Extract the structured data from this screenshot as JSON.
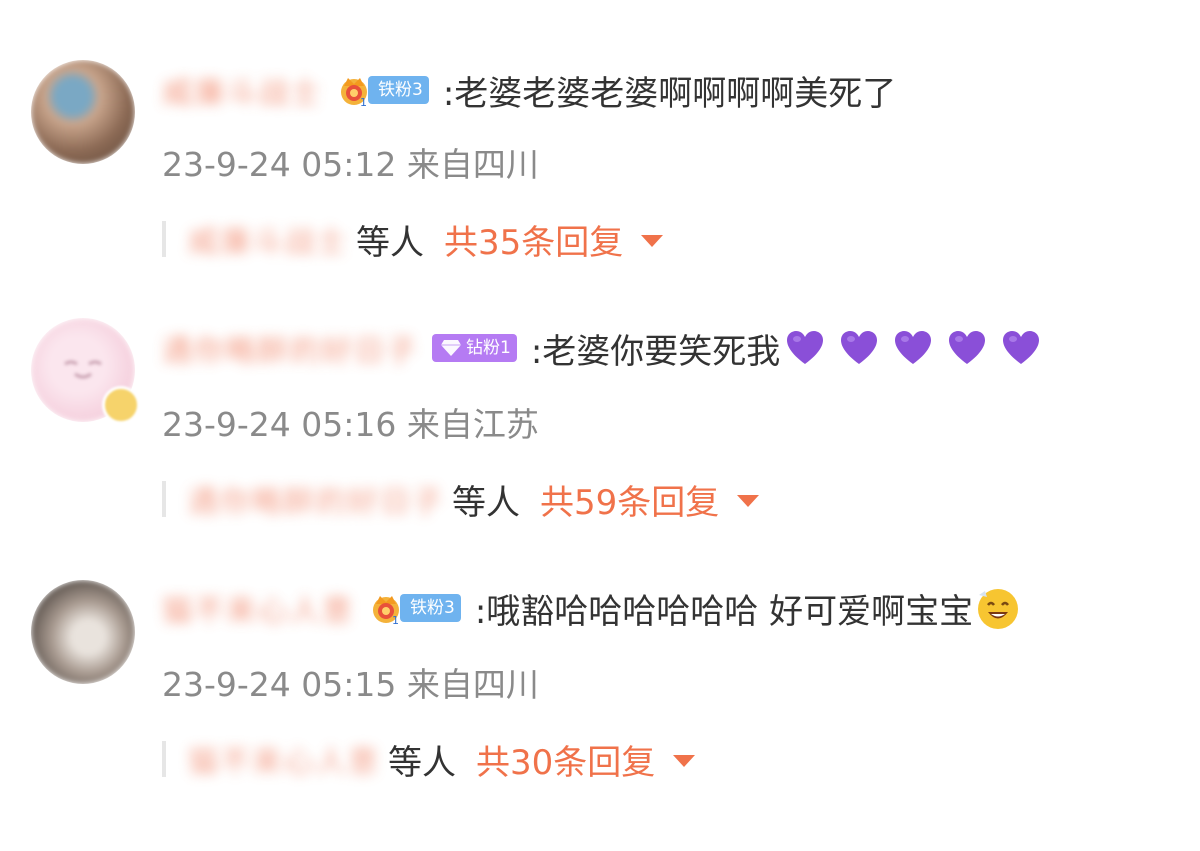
{
  "colors": {
    "username": "#f07a5a",
    "reply_accent": "#f0724a",
    "meta_gray": "#8a8a8a",
    "iron_badge": "#6fb3ef",
    "diamond_badge": "#b57bf3",
    "heart": "#8a4fd8"
  },
  "comments": [
    {
      "username": "威廉斗战士",
      "badge": {
        "type": "iron",
        "icon": "crown-icon",
        "label": "铁粉3"
      },
      "text": ":老婆老婆老婆啊啊啊啊美死了",
      "meta": "23-9-24 05:12 来自四川",
      "reply": {
        "user": "威廉斗战士",
        "etc": "等人",
        "count": "共35条回复"
      }
    },
    {
      "username": "遇你略醉的好日子",
      "badge": {
        "type": "diamond",
        "icon": "diamond-icon",
        "label": "钻粉1"
      },
      "text": ":老婆你要笑死我",
      "emojis": [
        "purple-heart-icon",
        "purple-heart-icon",
        "purple-heart-icon",
        "purple-heart-icon",
        "purple-heart-icon"
      ],
      "meta": "23-9-24 05:16 来自江苏",
      "reply": {
        "user": "遇你略醉的好日子",
        "etc": "等人",
        "count": "共59条回复"
      }
    },
    {
      "username": "猫不来心人意",
      "badge": {
        "type": "iron",
        "icon": "crown-icon",
        "label": "铁粉3"
      },
      "text": ":哦豁哈哈哈哈哈哈 好可爱啊宝宝",
      "emojis": [
        "grinning-face-icon"
      ],
      "meta": "23-9-24 05:15 来自四川",
      "reply": {
        "user": "猫不来心人意",
        "etc": "等人",
        "count": "共30条回复"
      }
    }
  ]
}
